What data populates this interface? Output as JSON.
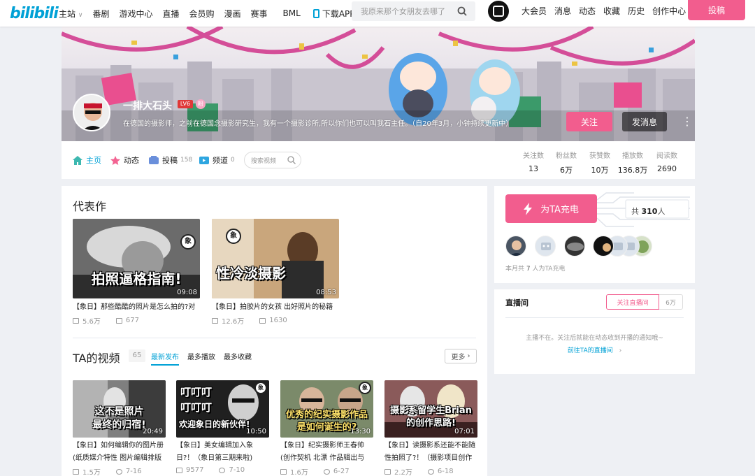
{
  "topbar": {
    "logo": "bilibili",
    "nav": [
      "主站",
      "番剧",
      "游戏中心",
      "直播",
      "会员购",
      "漫画",
      "赛事",
      "BML"
    ],
    "app_label": "下载APP",
    "search_placeholder": "我原来那个女朋友去哪了",
    "right_nav": [
      "大会员",
      "消息",
      "动态",
      "收藏",
      "历史",
      "创作中心"
    ],
    "upload_label": "投稿"
  },
  "profile": {
    "name": "一排大石头",
    "level": "LV6",
    "badge": "粉",
    "sign": "在德国的摄影师，之前在德国念摄影研究生，我有一个摄影诊所,所以你们也可以叫我石主任。（自20年3月，小钟持续更新中）",
    "follow_label": "关注",
    "message_label": "发消息",
    "more": "⋮"
  },
  "tabs": {
    "home": "主页",
    "dynamic": "动态",
    "videos": "投稿",
    "videos_count": "158",
    "channel": "频道",
    "channel_count": "0",
    "search_placeholder": "搜索视频"
  },
  "stats": [
    {
      "label": "关注数",
      "value": "13"
    },
    {
      "label": "粉丝数",
      "value": "6万"
    },
    {
      "label": "获赞数",
      "value": "10万"
    },
    {
      "label": "播放数",
      "value": "136.8万"
    },
    {
      "label": "阅读数",
      "value": "2690"
    }
  ],
  "masterpiece": {
    "title": "代表作",
    "videos": [
      {
        "caption": "拍照逼格指南!",
        "duration": "09:08",
        "title": "【象日】那些酷酷的照片是怎么拍的?对",
        "views": "5.6万",
        "danmaku": "677"
      },
      {
        "caption": "性冷淡摄影",
        "duration": "08:53",
        "title": "【象日】拍胶片的女孩 出好照片的秘籍",
        "views": "12.6万",
        "danmaku": "1630"
      }
    ]
  },
  "ta_videos": {
    "title": "TA的视频",
    "count": "65",
    "sort": [
      "最新发布",
      "最多播放",
      "最多收藏"
    ],
    "more_label": "更多",
    "videos": [
      {
        "caption1": "这不是照片",
        "caption2": "最终的归宿!",
        "duration": "20:49",
        "title1": "【象日】如何编辑你的图片册",
        "title2": "(纸质媒介特性 图片编辑排版",
        "views": "1.5万",
        "date": "7-16"
      },
      {
        "caption1": "叮叮叮",
        "caption2": "叮叮叮",
        "caption3": "欢迎象日的新伙伴!",
        "duration": "10:50",
        "title1": "【象日】美女编辑加入象",
        "title2": "日?！（象日第三期来啦)",
        "views": "9577",
        "date": "7-10"
      },
      {
        "caption1": "优秀的纪实摄影作品",
        "caption2": "是如何诞生的?",
        "duration": "13:30",
        "title1": "【象日】纪实摄影师王春帅",
        "title2": "(创作契机 北漂 作品辑出与",
        "views": "1.6万",
        "date": "6-27"
      },
      {
        "caption1": "摄影系留学生Brian",
        "caption2": "的创作思路!",
        "duration": "07:01",
        "title1": "【象日】读摄影系还能不能随",
        "title2": "性拍照了?！（摄影项目创作",
        "views": "2.2万",
        "date": "6-18"
      }
    ]
  },
  "charge": {
    "button_label": "为TA充电",
    "total_prefix": "共",
    "total": "310",
    "total_suffix": "人",
    "note_prefix": "本月共",
    "note_count": "7",
    "note_suffix": "人为TA充电"
  },
  "live": {
    "title": "直播间",
    "follow_label": "关注直播间",
    "follow_count": "6万",
    "message": "主播不在。关注后就能在动态收到开播的通知哦~",
    "link": "前往TA的直播间"
  },
  "colors": {
    "brand_blue": "#00a1d6",
    "brand_pink": "#f25d8e"
  }
}
